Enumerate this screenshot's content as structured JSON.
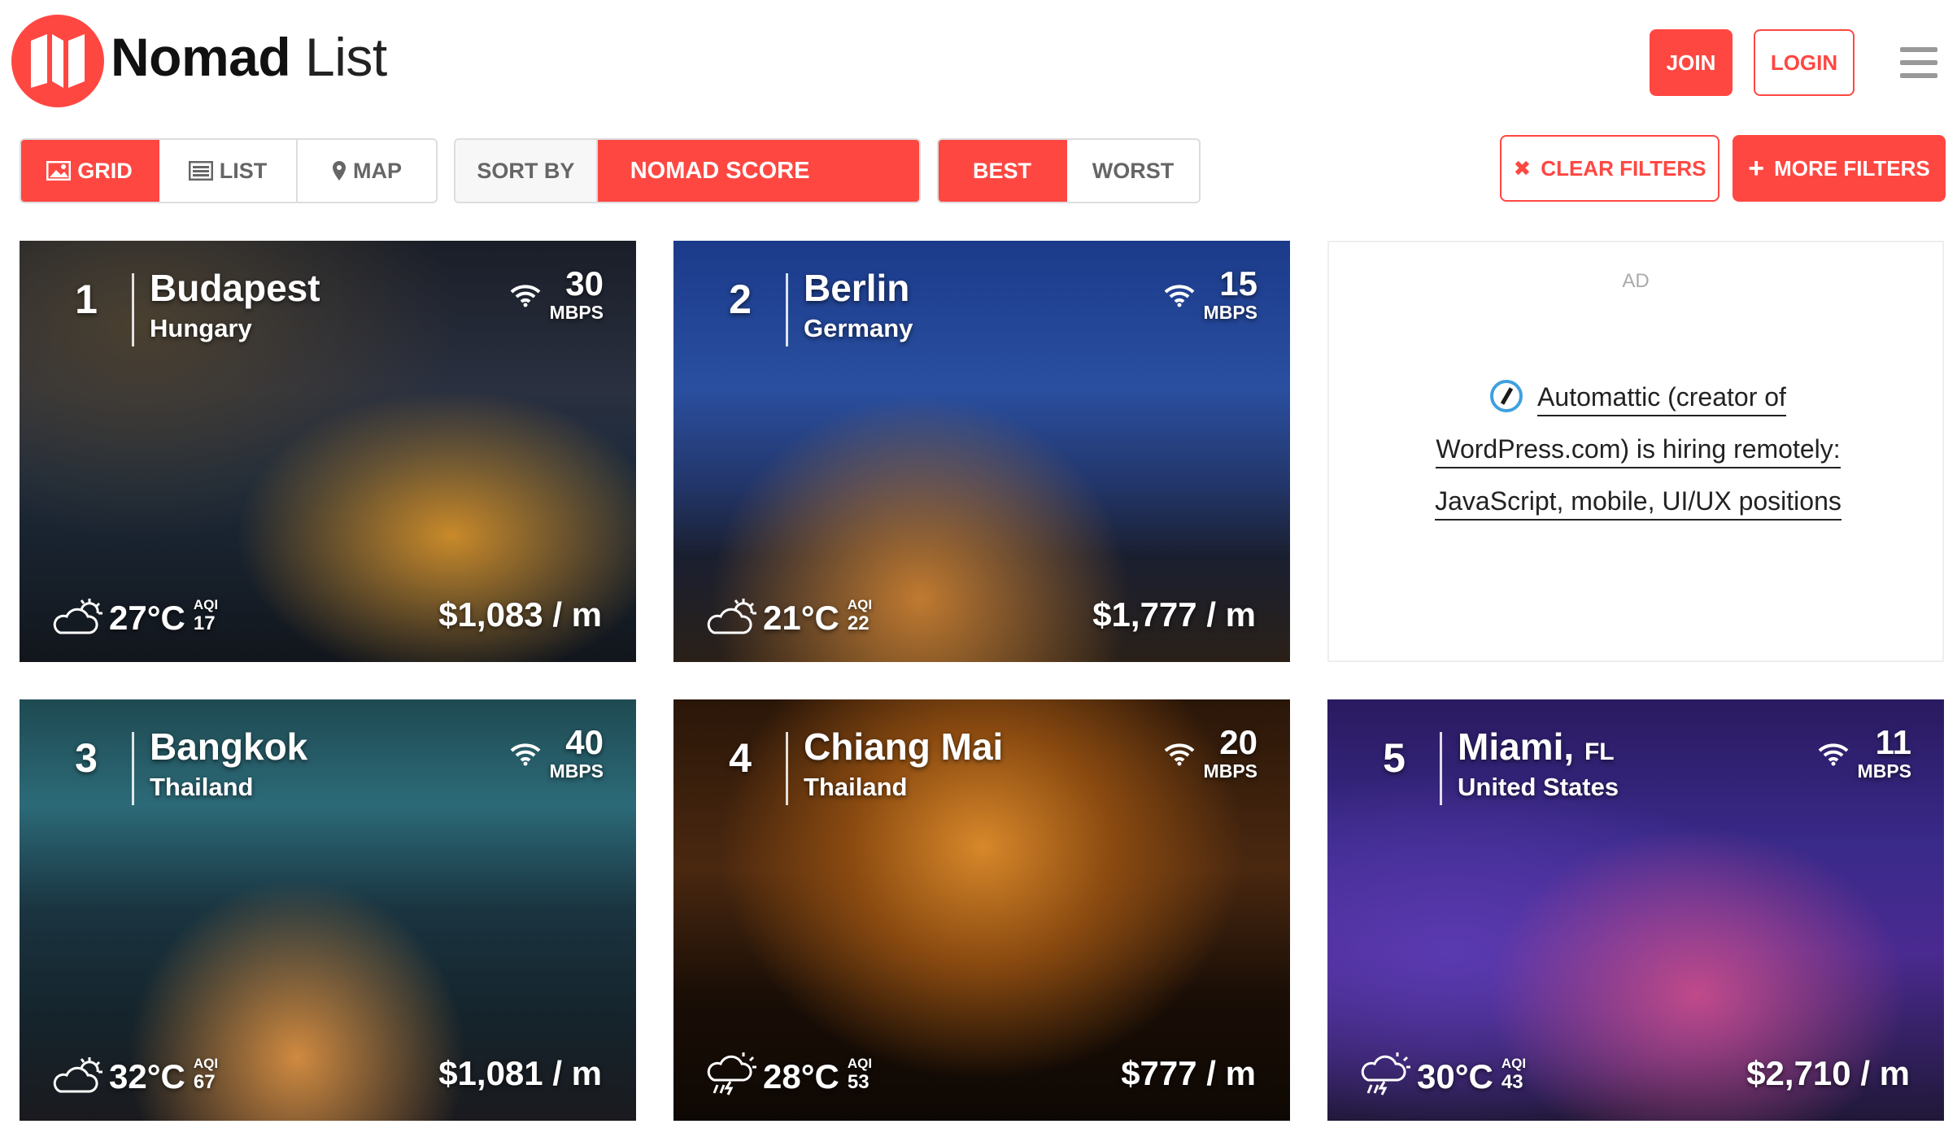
{
  "brand": {
    "bold": "Nomad",
    "light": "List"
  },
  "header": {
    "join_label": "JOIN",
    "login_label": "LOGIN"
  },
  "toolbar": {
    "views": [
      {
        "label": "GRID",
        "icon": "image-icon"
      },
      {
        "label": "LIST",
        "icon": "list-icon"
      },
      {
        "label": "MAP",
        "icon": "map-pin-icon"
      }
    ],
    "sort_by_label": "SORT BY",
    "sort_value": "NOMAD SCORE",
    "best_label": "BEST",
    "worst_label": "WORST",
    "clear_filters_label": "CLEAR FILTERS",
    "more_filters_label": "MORE FILTERS"
  },
  "ad": {
    "label": "AD",
    "line1": "Automattic (creator of",
    "line2": "WordPress.com) is hiring remotely:",
    "line3": "JavaScript, mobile, UI/UX positions"
  },
  "cities": [
    {
      "rank": "1",
      "city": "Budapest",
      "state": "",
      "country": "Hungary",
      "speed": "30",
      "unit": "MBPS",
      "weather_icon": "sun-cloud-icon",
      "temp": "27°C",
      "aqi_label": "AQI",
      "aqi": "17",
      "price": "$1,083 / m"
    },
    {
      "rank": "2",
      "city": "Berlin",
      "state": "",
      "country": "Germany",
      "speed": "15",
      "unit": "MBPS",
      "weather_icon": "sun-cloud-icon",
      "temp": "21°C",
      "aqi_label": "AQI",
      "aqi": "22",
      "price": "$1,777 / m"
    },
    {
      "rank": "3",
      "city": "Bangkok",
      "state": "",
      "country": "Thailand",
      "speed": "40",
      "unit": "MBPS",
      "weather_icon": "sun-cloud-icon",
      "temp": "32°C",
      "aqi_label": "AQI",
      "aqi": "67",
      "price": "$1,081 / m"
    },
    {
      "rank": "4",
      "city": "Chiang Mai",
      "state": "",
      "country": "Thailand",
      "speed": "20",
      "unit": "MBPS",
      "weather_icon": "thunderstorm-icon",
      "temp": "28°C",
      "aqi_label": "AQI",
      "aqi": "53",
      "price": "$777 / m"
    },
    {
      "rank": "5",
      "city": "Miami,",
      "state": "FL",
      "country": "United States",
      "speed": "11",
      "unit": "MBPS",
      "weather_icon": "thunderstorm-icon",
      "temp": "30°C",
      "aqi_label": "AQI",
      "aqi": "43",
      "price": "$2,710 / m"
    }
  ],
  "colors": {
    "accent": "#ff4742"
  }
}
